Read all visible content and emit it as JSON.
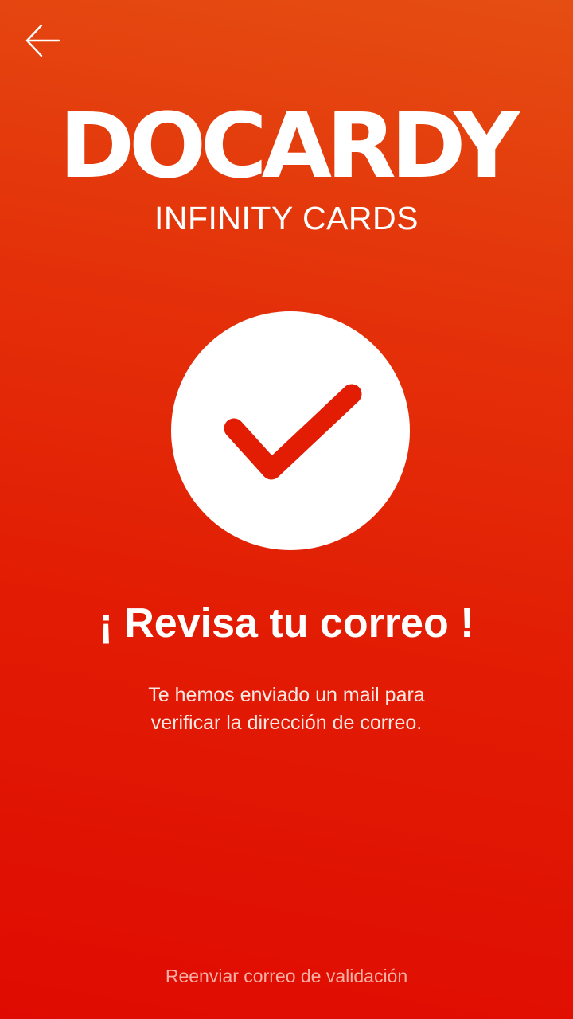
{
  "header": {
    "back_icon": "arrow-left-icon"
  },
  "brand": {
    "name": "DOCARDY",
    "tagline": "INFINITY CARDS"
  },
  "status": {
    "icon": "checkmark-icon",
    "title": "¡ Revisa tu correo !",
    "message_line1": "Te hemos enviado un mail para",
    "message_line2": "verificar la dirección de correo."
  },
  "footer": {
    "resend_label": "Reenviar correo de validación"
  },
  "colors": {
    "background_top": "#e54e12",
    "background_bottom": "#df0b02",
    "accent": "#e21d04",
    "foreground": "#ffffff"
  }
}
